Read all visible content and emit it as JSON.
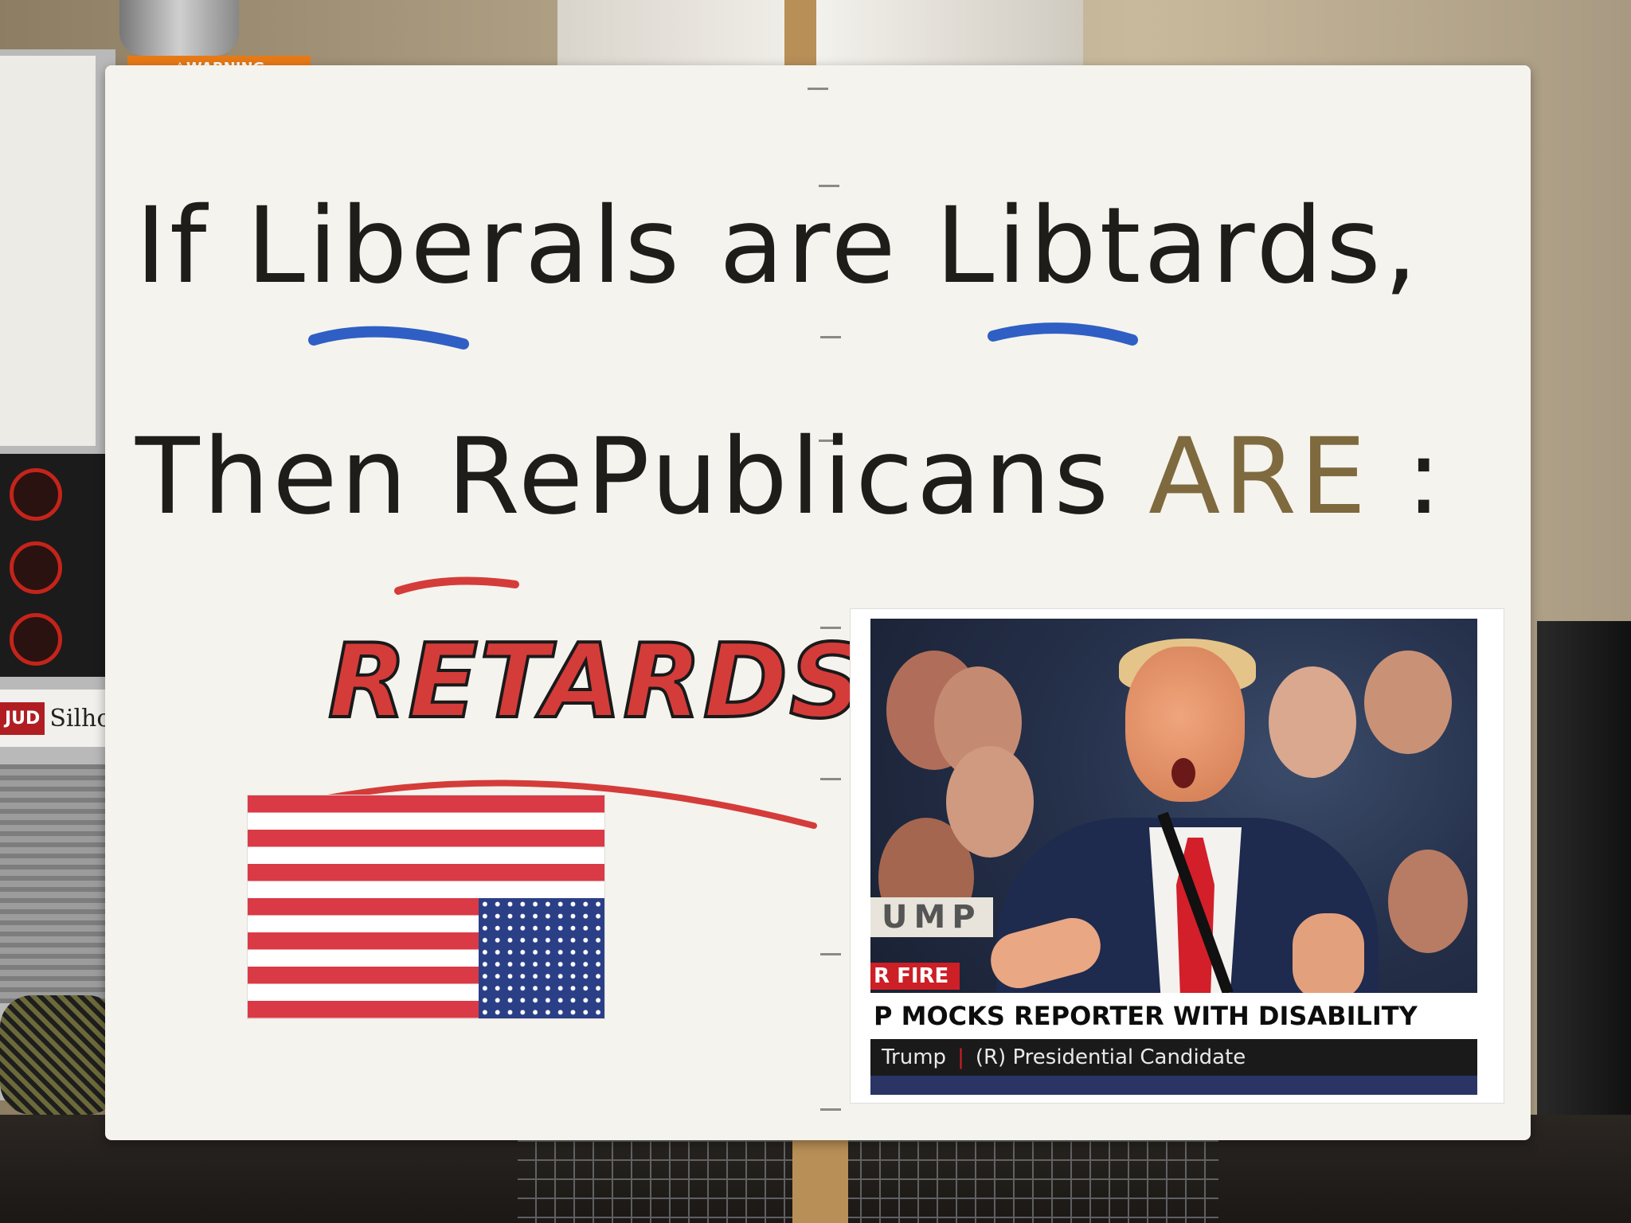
{
  "background": {
    "warning_label": "⚠WARNING",
    "brand_badge": "JUD",
    "brand_name": "Silhou"
  },
  "sign": {
    "line1": {
      "w1": "If",
      "w2": "Liberals",
      "w3": "are",
      "w4": "Libtards,"
    },
    "line2": {
      "w1": "Then",
      "w2": "RePublicans",
      "w3": "ARE",
      "w4": ":"
    },
    "line3": "RETARDS",
    "colors": {
      "ink": "#1f1d1a",
      "underline_blue": "#2f5fc4",
      "underline_red": "#d43c3a",
      "gold": "#7e6a3e"
    }
  },
  "flag": {
    "orientation": "upside-down",
    "stripe_red": "#d93a45",
    "union_blue": "#2b3f86"
  },
  "photo": {
    "banner": "UMP",
    "chyron_tag": "R FIRE",
    "chyron_headline": "P MOCKS REPORTER WITH DISABILITY",
    "chyron_name": "Trump",
    "chyron_role": "(R) Presidential Candidate",
    "chyron_red": "#cc1f26"
  }
}
